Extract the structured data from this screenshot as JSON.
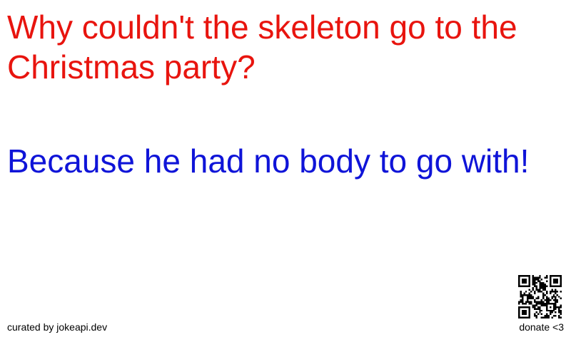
{
  "joke": {
    "setup": "Why couldn't the skeleton go to the Christmas party?",
    "delivery": "Because he had no body to go with!",
    "setup_color": "#e8140e",
    "delivery_color": "#0f14d8"
  },
  "footer": {
    "credit": "curated by jokeapi.dev",
    "donate": "donate <3"
  },
  "qr": {
    "icon": "qr-code-icon",
    "color": "#000000"
  }
}
